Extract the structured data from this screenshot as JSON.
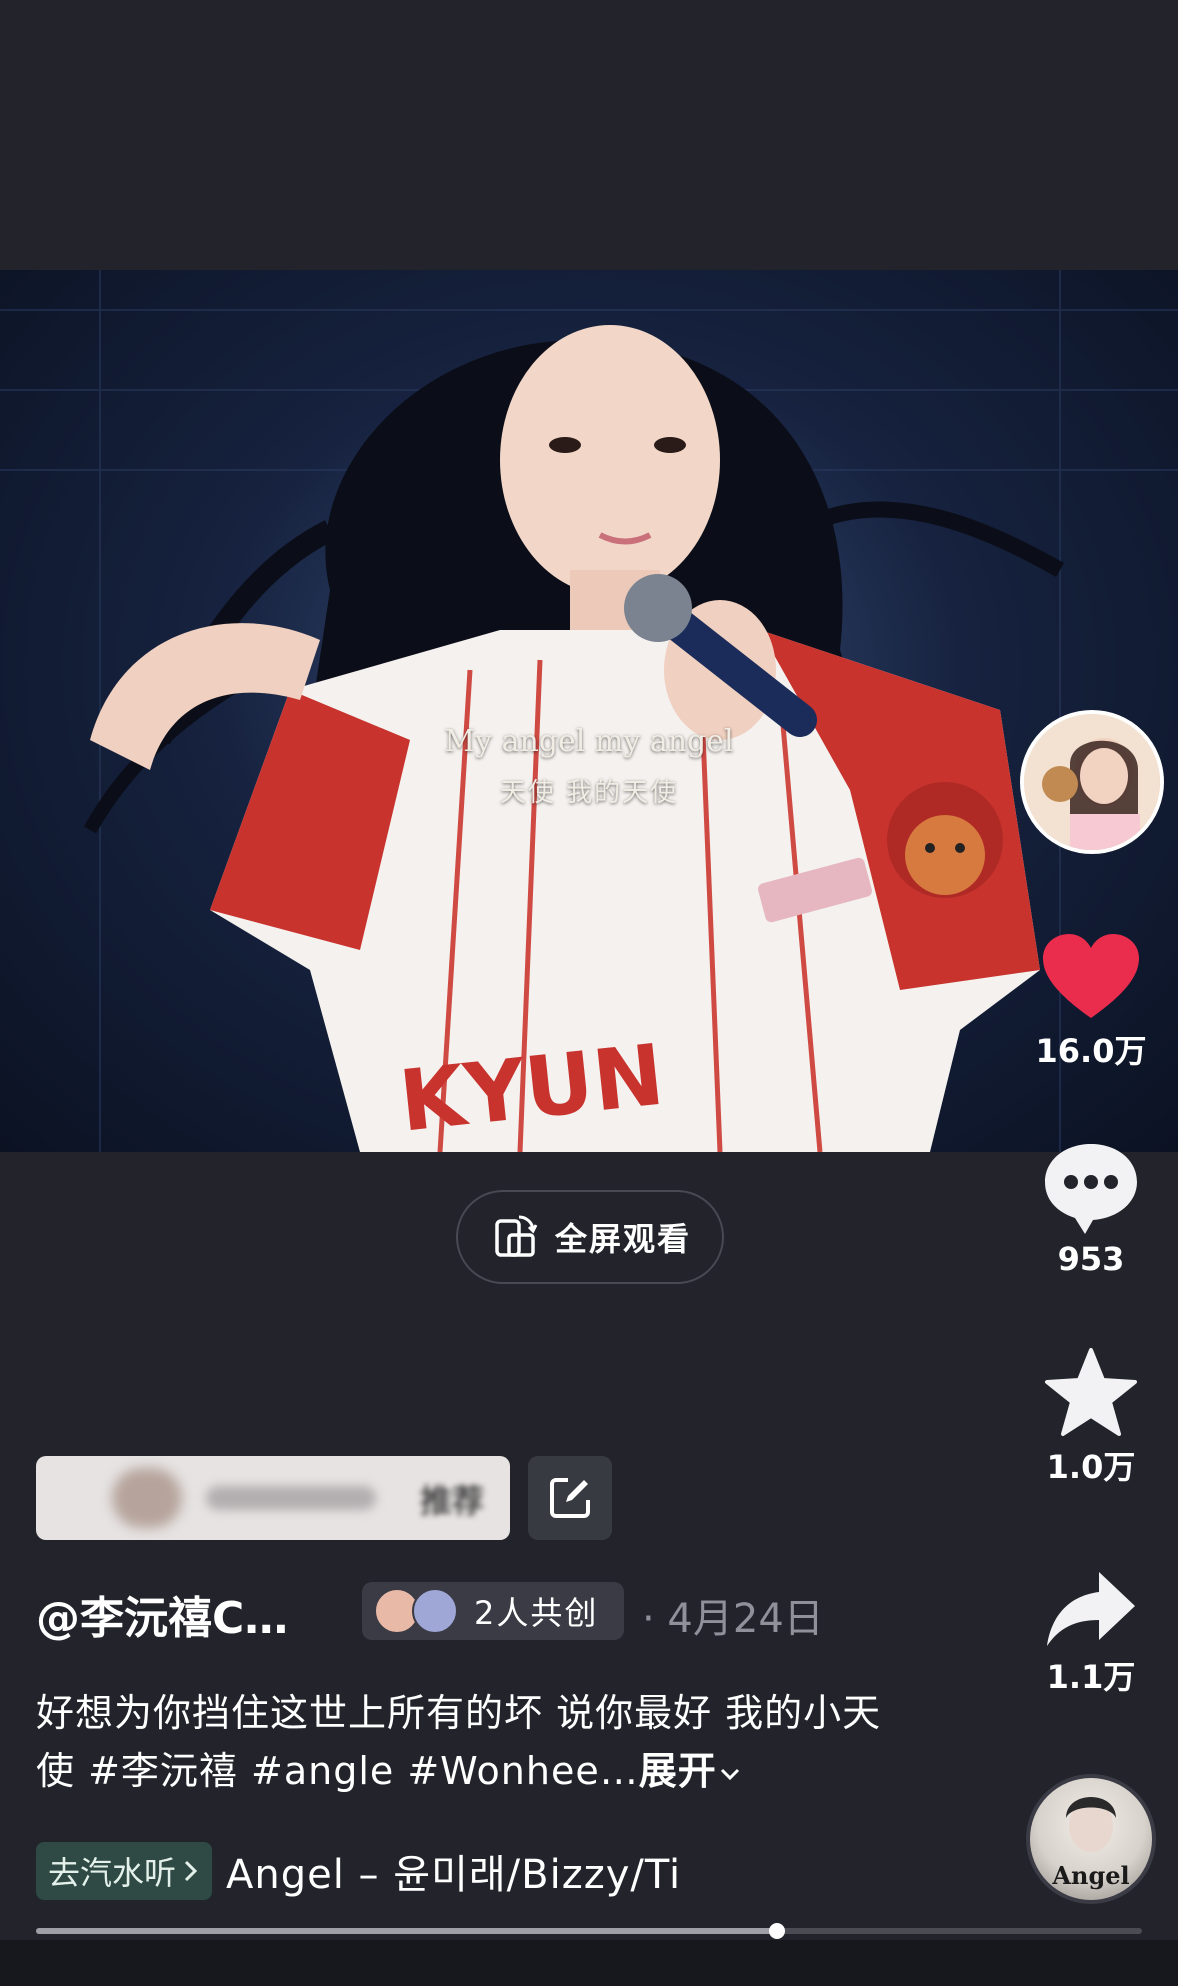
{
  "video": {
    "subtitle_en": "My angel my angel",
    "subtitle_cn": "天使 我的天使",
    "jersey_text": "KYUN"
  },
  "fullscreen_label": "全屏观看",
  "side": {
    "like_count": "16.0万",
    "comment_count": "953",
    "favorite_count": "1.0万",
    "share_count": "1.1万"
  },
  "recommend_label": "推荐",
  "author": "@李沅禧C…",
  "cocreate_label": "2人共创",
  "date": "· 4月24日",
  "description": "好想为你挡住这世上所有的坏 说你最好 我的小天使 #李沅禧 #angle #Wonhee…",
  "expand_label": "展开",
  "music": {
    "tag_label": "去汽水听",
    "song": "Angel – 윤미래/Bizzy/Ti",
    "disc_word": "Angel"
  },
  "progress": 0.67,
  "colors": {
    "background": "#22232b",
    "like": "#ea2c4d",
    "music_tag": "#2f4a45"
  }
}
